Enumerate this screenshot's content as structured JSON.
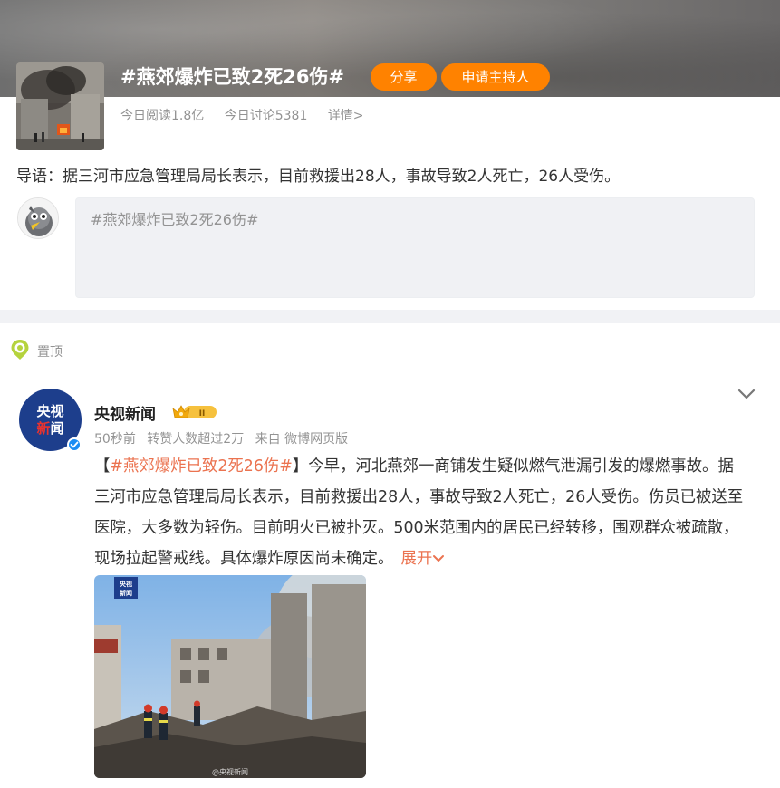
{
  "topic": {
    "title": "#燕郊爆炸已致2死26伤#",
    "share_label": "分享",
    "apply_host_label": "申请主持人",
    "reads": "今日阅读1.8亿",
    "discussions": "今日讨论5381",
    "detail_label": "详情>",
    "guide": "导语：据三河市应急管理局局长表示，目前救援出28人，事故导致2人死亡，26人受伤。",
    "composer_text": "#燕郊爆炸已致2死26伤#"
  },
  "feed": {
    "pin_label": "置顶",
    "post": {
      "author": "央视新闻",
      "avatar_text": [
        "央视",
        "新",
        "闻"
      ],
      "time": "50秒前",
      "reposts": "转赞人数超过2万",
      "source": "来自 微博网页版",
      "bracket_open": "【",
      "tag": "#燕郊爆炸已致2死26伤#",
      "bracket_close": "】",
      "body": "今早，河北燕郊一商铺发生疑似燃气泄漏引发的爆燃事故。据三河市应急管理局局长表示，目前救援出28人，事故导致2人死亡，26人受伤。伤员已被送至医院，大多数为轻伤。目前明火已被扑灭。500米范围内的居民已经转移，围观群众被疏散，现场拉起警戒线。具体爆炸原因尚未确定。",
      "expand_label": "展开",
      "image_logo": [
        "央视",
        "新闻"
      ],
      "watermark": "@央视新闻"
    }
  },
  "colors": {
    "accent_orange": "#ff8200",
    "link_orange": "#eb7350",
    "muted": "#939393",
    "verify_blue": "#1b8cf3",
    "cctv_blue": "#1d3e8c"
  }
}
